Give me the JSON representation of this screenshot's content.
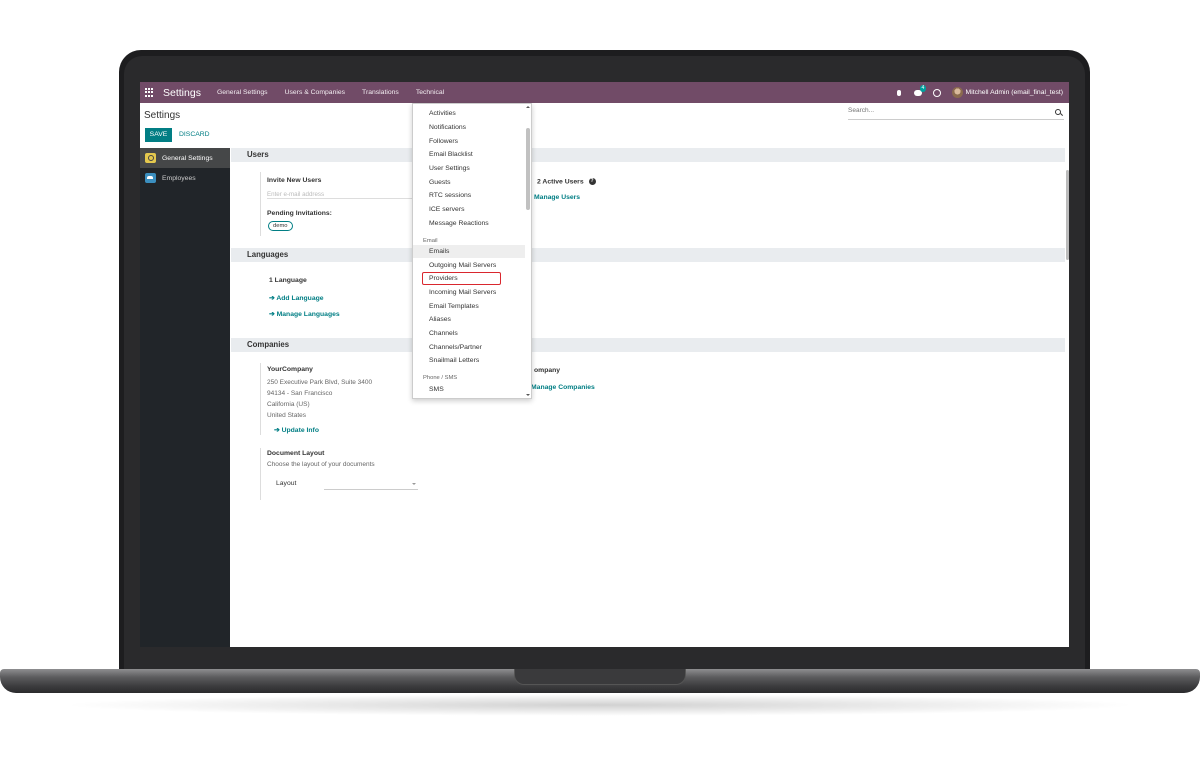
{
  "navbar": {
    "brand": "Settings",
    "menu": [
      "General Settings",
      "Users & Companies",
      "Translations",
      "Technical"
    ],
    "chat_count": "4",
    "user": "Mitchell Admin (email_final_test)"
  },
  "control_panel": {
    "title": "Settings",
    "save_label": "SAVE",
    "discard_label": "DISCARD",
    "search_placeholder": "Search..."
  },
  "sidebar": {
    "items": [
      {
        "label": "General Settings",
        "icon": "gear-icon",
        "active": true
      },
      {
        "label": "Employees",
        "icon": "people-icon",
        "active": false
      }
    ]
  },
  "users_section": {
    "title": "Users",
    "invite_label": "Invite New Users",
    "invite_placeholder": "Enter e-mail address",
    "pending_label": "Pending Invitations:",
    "pending_tag": "demo",
    "active_users": "2 Active Users",
    "manage_users": "Manage Users"
  },
  "languages_section": {
    "title": "Languages",
    "count": "1 Language",
    "add": "Add Language",
    "manage": "Manage Languages"
  },
  "companies_section": {
    "title": "Companies",
    "company_name": "YourCompany",
    "address1": "250 Executive Park Blvd, Suite 3400",
    "address2": "94134 - San Francisco",
    "address3": "California (US)",
    "address4": "United States",
    "update_info": "Update Info",
    "company_partial": "ompany",
    "manage_companies": "Manage Companies",
    "doc_layout_title": "Document Layout",
    "doc_layout_desc": "Choose the layout of your documents",
    "layout_label": "Layout"
  },
  "technical_dropdown": {
    "group1_items": [
      "Activities",
      "Notifications",
      "Followers",
      "Email Blacklist",
      "User Settings",
      "Guests",
      "RTC sessions",
      "ICE servers",
      "Message Reactions"
    ],
    "email_header": "Email",
    "email_items": [
      "Emails",
      "Outgoing Mail Servers",
      "Providers",
      "Incoming Mail Servers",
      "Email Templates",
      "Aliases",
      "Channels",
      "Channels/Partner",
      "Snailmail Letters"
    ],
    "phone_header": "Phone / SMS",
    "phone_items": [
      "SMS"
    ],
    "hovered_item": "Emails",
    "highlighted_item": "Providers"
  },
  "colors": {
    "navbar": "#714b67",
    "primary": "#017e84",
    "sidebar": "#212529",
    "highlight_box": "#d9272e"
  }
}
